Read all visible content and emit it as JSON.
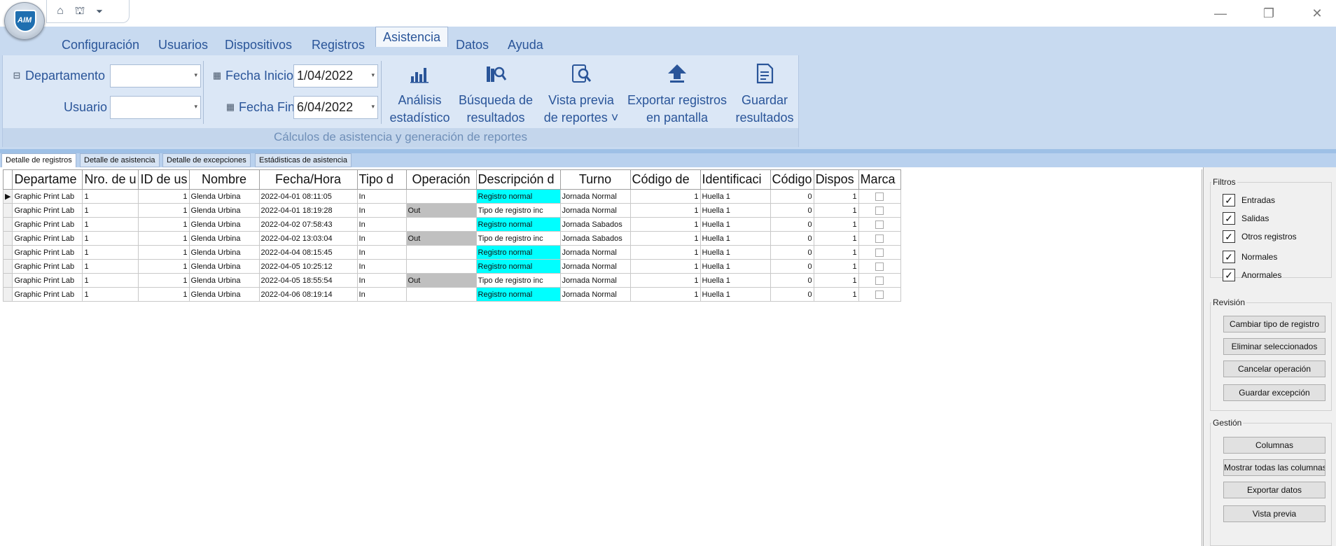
{
  "logo": {
    "text": "AIM"
  },
  "quick_access": [
    {
      "icon": "home-icon",
      "glyph": "⌂"
    },
    {
      "icon": "fingerprint-device-icon",
      "glyph": "⛫"
    },
    {
      "icon": "qat-dropdown-icon",
      "glyph": "⏷"
    }
  ],
  "window_controls": {
    "minimize": "—",
    "restore": "❐",
    "close": "✕"
  },
  "menu": {
    "tabs": [
      "Configuración",
      "Usuarios",
      "Dispositivos",
      "Registros",
      "Asistencia",
      "Datos",
      "Ayuda"
    ],
    "active": "Asistencia"
  },
  "ribbon": {
    "departamento_label": "Departamento",
    "departamento_value": "",
    "usuario_label": "Usuario",
    "usuario_value": "",
    "fecha_inicio_label": "Fecha Inicio",
    "fecha_inicio_value": "1/04/2022",
    "fecha_fin_label": "Fecha Fin",
    "fecha_fin_value": "6/04/2022",
    "buttons": [
      {
        "line1": "Análisis",
        "line2": "estadístico",
        "icon": "bar-chart-icon"
      },
      {
        "line1": "Búsqueda de",
        "line2": "resultados",
        "icon": "search-books-icon"
      },
      {
        "line1": "Vista previa",
        "line2": "de reportes ˅",
        "icon": "report-preview-icon"
      },
      {
        "line1": "Exportar registros",
        "line2": "en pantalla",
        "icon": "export-up-arrow-icon"
      },
      {
        "line1": "Guardar",
        "line2": "resultados",
        "icon": "save-document-icon"
      }
    ],
    "group_label": "Cálculos de asistencia y generación de reportes"
  },
  "subtabs": [
    "Detalle de registros",
    "Detalle de asistencia",
    "Detalle de excepciones",
    "Estádisticas de asistencia"
  ],
  "grid": {
    "columns": [
      "Departame",
      "Nro. de u",
      "ID de us",
      "Nombre",
      "Fecha/Hora",
      "Tipo d",
      "Operación",
      "Descripción d",
      "Turno",
      "Código de",
      "Identificaci",
      "Código",
      "Dispos",
      "Marca"
    ],
    "rows": [
      {
        "dept": "Graphic Print Lab",
        "nro": "1",
        "id": "1",
        "nombre": "Glenda Urbina",
        "fecha": "2022-04-01 08:11:05",
        "tipo": "In",
        "op": "",
        "desc": "Registro normal",
        "turno": "Jornada Normal",
        "codigo": "1",
        "ident": "Huella 1",
        "cod2": "0",
        "disp": "1",
        "desc_color": "#00ffff",
        "op_color": "#ffffff"
      },
      {
        "dept": "Graphic Print Lab",
        "nro": "1",
        "id": "1",
        "nombre": "Glenda Urbina",
        "fecha": "2022-04-01 18:19:28",
        "tipo": "In",
        "op": "Out",
        "desc": "Tipo de registro inc",
        "turno": "Jornada Normal",
        "codigo": "1",
        "ident": "Huella 1",
        "cod2": "0",
        "disp": "1",
        "desc_color": "#ffffff",
        "op_color": "#c0c0c0"
      },
      {
        "dept": "Graphic Print Lab",
        "nro": "1",
        "id": "1",
        "nombre": "Glenda Urbina",
        "fecha": "2022-04-02 07:58:43",
        "tipo": "In",
        "op": "",
        "desc": "Registro normal",
        "turno": "Jornada Sabados",
        "codigo": "1",
        "ident": "Huella 1",
        "cod2": "0",
        "disp": "1",
        "desc_color": "#00ffff",
        "op_color": "#ffffff"
      },
      {
        "dept": "Graphic Print Lab",
        "nro": "1",
        "id": "1",
        "nombre": "Glenda Urbina",
        "fecha": "2022-04-02 13:03:04",
        "tipo": "In",
        "op": "Out",
        "desc": "Tipo de registro inc",
        "turno": "Jornada Sabados",
        "codigo": "1",
        "ident": "Huella 1",
        "cod2": "0",
        "disp": "1",
        "desc_color": "#ffffff",
        "op_color": "#c0c0c0"
      },
      {
        "dept": "Graphic Print Lab",
        "nro": "1",
        "id": "1",
        "nombre": "Glenda Urbina",
        "fecha": "2022-04-04 08:15:45",
        "tipo": "In",
        "op": "",
        "desc": "Registro normal",
        "turno": "Jornada Normal",
        "codigo": "1",
        "ident": "Huella 1",
        "cod2": "0",
        "disp": "1",
        "desc_color": "#00ffff",
        "op_color": "#ffffff"
      },
      {
        "dept": "Graphic Print Lab",
        "nro": "1",
        "id": "1",
        "nombre": "Glenda Urbina",
        "fecha": "2022-04-05 10:25:12",
        "tipo": "In",
        "op": "",
        "desc": "Registro normal",
        "turno": "Jornada Normal",
        "codigo": "1",
        "ident": "Huella 1",
        "cod2": "0",
        "disp": "1",
        "desc_color": "#00ffff",
        "op_color": "#ffffff"
      },
      {
        "dept": "Graphic Print Lab",
        "nro": "1",
        "id": "1",
        "nombre": "Glenda Urbina",
        "fecha": "2022-04-05 18:55:54",
        "tipo": "In",
        "op": "Out",
        "desc": "Tipo de registro inc",
        "turno": "Jornada Normal",
        "codigo": "1",
        "ident": "Huella 1",
        "cod2": "0",
        "disp": "1",
        "desc_color": "#ffffff",
        "op_color": "#c0c0c0"
      },
      {
        "dept": "Graphic Print Lab",
        "nro": "1",
        "id": "1",
        "nombre": "Glenda Urbina",
        "fecha": "2022-04-06 08:19:14",
        "tipo": "In",
        "op": "",
        "desc": "Registro normal",
        "turno": "Jornada Normal",
        "codigo": "1",
        "ident": "Huella 1",
        "cod2": "0",
        "disp": "1",
        "desc_color": "#00ffff",
        "op_color": "#ffffff"
      }
    ]
  },
  "filtros": {
    "title": "Filtros",
    "items": [
      {
        "label": "Entradas",
        "checked": true
      },
      {
        "label": "Salidas",
        "checked": true
      },
      {
        "label": "Otros registros",
        "checked": true
      },
      {
        "label": "Normales",
        "checked": true
      },
      {
        "label": "Anormales",
        "checked": true
      }
    ]
  },
  "revision": {
    "title": "Revisión",
    "buttons": [
      "Cambiar tipo de registro",
      "Eliminar seleccionados",
      "Cancelar operación",
      "Guardar excepción"
    ]
  },
  "gestion": {
    "title": "Gestión",
    "buttons": [
      "Columnas",
      "Mostrar todas las columnas",
      "Exportar datos",
      "Vista previa"
    ]
  }
}
